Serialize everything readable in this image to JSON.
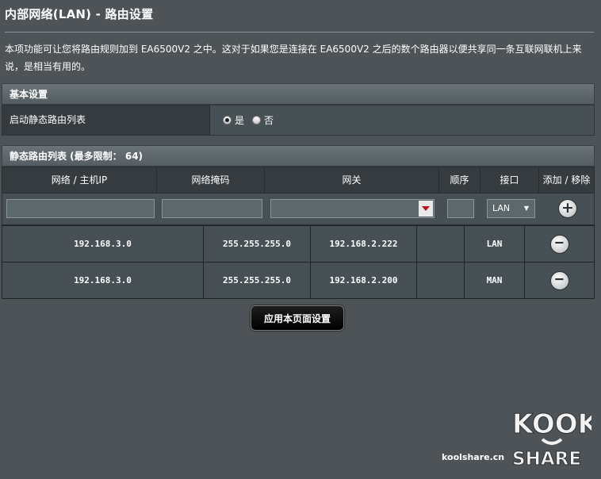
{
  "page": {
    "title": "内部网络(LAN) - 路由设置",
    "description": "本项功能可让您将路由规则加到 EA6500V2 之中。这对于如果您是连接在 EA6500V2 之后的数个路由器以便共享同一条互联网联机上来说，是相当有用的。"
  },
  "basic": {
    "header": "基本设置",
    "static_route_label": "启动静态路由列表",
    "radio_yes": "是",
    "radio_no": "否",
    "selected": "是"
  },
  "route_list": {
    "header": "静态路由列表 (最多限制： 64)",
    "columns": [
      "网络 / 主机IP",
      "网络掩码",
      "网关",
      "顺序",
      "接口",
      "添加 / 移除"
    ],
    "input_row": {
      "network": "",
      "netmask": "",
      "gateway": "",
      "metric": "",
      "interface": "LAN"
    },
    "rows": [
      {
        "network": "192.168.3.0",
        "netmask": "255.255.255.0",
        "gateway": "192.168.2.222",
        "metric": "",
        "interface": "LAN"
      },
      {
        "network": "192.168.3.0",
        "netmask": "255.255.255.0",
        "gateway": "192.168.2.200",
        "metric": "",
        "interface": "MAN"
      }
    ]
  },
  "apply_button": "应用本页面设置",
  "watermark": {
    "site": "koolshare.cn",
    "logo_top": "KOOK",
    "logo_bottom": "SHARE"
  },
  "icons": {
    "add": "plus-circle-icon",
    "remove": "minus-circle-icon",
    "dropdown": "chevron-down-icon"
  }
}
